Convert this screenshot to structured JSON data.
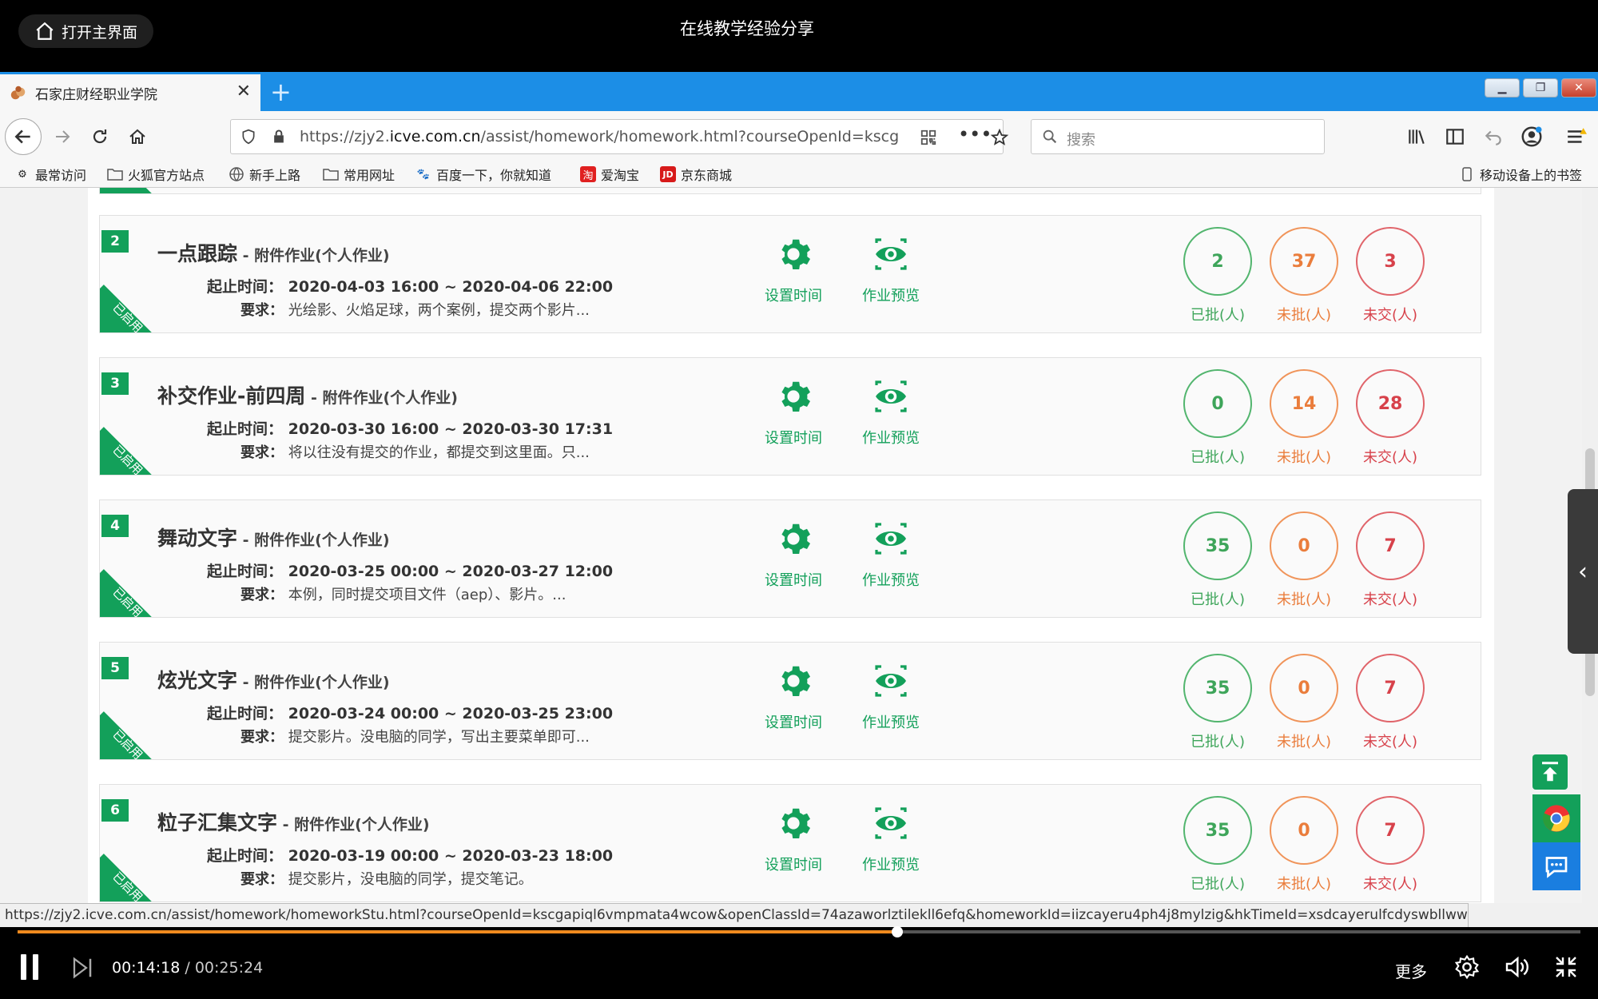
{
  "player": {
    "home_label": "打开主界面",
    "title": "在线教学经验分享",
    "current_time": "00:14:18",
    "separator": " / ",
    "total_time": "00:25:24",
    "progress": 0.563,
    "more_label": "更多"
  },
  "browser": {
    "tab_title": "石家庄财经职业学院",
    "url_prefix": "https://zjy2.",
    "url_domain": "icve.com.cn",
    "url_rest": "/assist/homework/homework.html?courseOpenId=kscg",
    "search_placeholder": "搜索",
    "bookmarks": [
      "最常访问",
      "火狐官方站点",
      "新手上路",
      "常用网址",
      "百度一下，你就知道",
      "爱淘宝",
      "京东商城"
    ],
    "mobile_bookmarks": "移动设备上的书签",
    "hover_url": "https://zjy2.icve.com.cn/assist/homework/homeworkStu.html?courseOpenId=kscgapiql6vmpmata4wcow&openClassId=74azaworlztilekll6efq&homeworkId=iizcayeru4ph4j8mylzig&hkTimeId=xsdcayerulfcdyswbllwwa"
  },
  "labels": {
    "time_label": "起止时间：",
    "req_label": "要求：",
    "status": "已启用",
    "set_time": "设置时间",
    "preview": "作业预览",
    "graded": "已批(人)",
    "ungraded": "未批(人)",
    "unsubmitted": "未交(人)"
  },
  "homeworks": [
    {
      "num": "2",
      "name": "一点跟踪",
      "type": " - 附件作业(个人作业)",
      "time": "2020-04-03 16:00 ~ 2020-04-06 22:00",
      "req": "光绘影、火焰足球，两个案例，提交两个影片...",
      "graded": "2",
      "ungraded": "37",
      "unsubmitted": "3"
    },
    {
      "num": "3",
      "name": "补交作业-前四周",
      "type": " - 附件作业(个人作业)",
      "time": "2020-03-30 16:00 ~ 2020-03-30 17:31",
      "req": "将以往没有提交的作业，都提交到这里面。只...",
      "graded": "0",
      "ungraded": "14",
      "unsubmitted": "28"
    },
    {
      "num": "4",
      "name": "舞动文字",
      "type": " - 附件作业(个人作业)",
      "time": "2020-03-25 00:00 ~ 2020-03-27 12:00",
      "req": "本例，同时提交项目文件（aep）、影片。...",
      "graded": "35",
      "ungraded": "0",
      "unsubmitted": "7"
    },
    {
      "num": "5",
      "name": "炫光文字",
      "type": " - 附件作业(个人作业)",
      "time": "2020-03-24 00:00 ~ 2020-03-25 23:00",
      "req": "提交影片。没电脑的同学，写出主要菜单即可...",
      "graded": "35",
      "ungraded": "0",
      "unsubmitted": "7"
    },
    {
      "num": "6",
      "name": "粒子汇集文字",
      "type": " - 附件作业(个人作业)",
      "time": "2020-03-19 00:00 ~ 2020-03-23 18:00",
      "req": "提交影片，没电脑的同学，提交笔记。",
      "graded": "35",
      "ungraded": "0",
      "unsubmitted": "7"
    }
  ],
  "colors": {
    "accent": "#13a05a",
    "graded": "#3ea55a",
    "ungraded": "#ea7d3c",
    "unsubmitted": "#d7414a",
    "tabbar": "#1c8ee6",
    "progress": "#f08a1e"
  }
}
